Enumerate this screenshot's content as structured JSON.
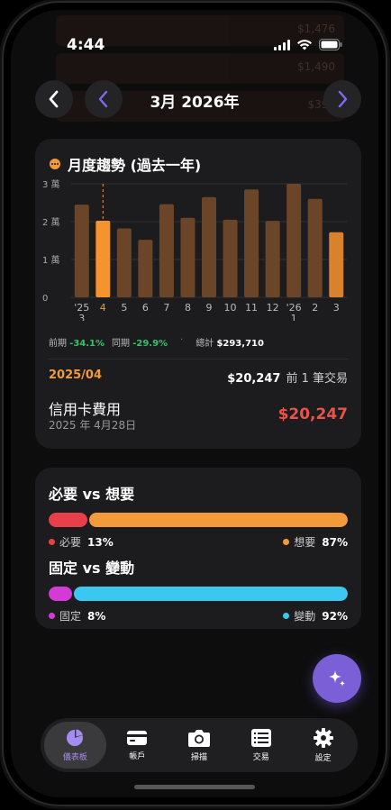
{
  "status": {
    "time": "4:44"
  },
  "background_rows": [
    {
      "amount": "$1,476"
    },
    {
      "amount": "$1,490"
    },
    {
      "amount": "$390"
    }
  ],
  "nav": {
    "title": "3月 2026年"
  },
  "trend": {
    "title": "月度趨勢 (過去一年)",
    "stats": {
      "prev_label": "前期",
      "prev_value": "-34.1%",
      "yoy_label": "同期",
      "yoy_value": "-29.9%",
      "sep": "·",
      "total_label": "總計",
      "total_value": "$293,710"
    },
    "selected": {
      "period": "2025/04",
      "amount": "$20,247",
      "count_text": "前 1 筆交易",
      "tx_name": "信用卡費用",
      "tx_date": "2025 年 4月28日",
      "tx_amount": "$20,247"
    },
    "colors": {
      "bar": "#6b4528",
      "highlight": "#f5942e",
      "current": "#d9822b"
    }
  },
  "chart_data": {
    "type": "bar",
    "title": "月度趨勢 (過去一年)",
    "categories": [
      "'25\n3",
      "4",
      "5",
      "6",
      "7",
      "8",
      "9",
      "10",
      "11",
      "12",
      "'26\n1",
      "2",
      "3"
    ],
    "values": [
      24500,
      20247,
      18200,
      15200,
      24600,
      21000,
      26500,
      20500,
      28500,
      20200,
      30000,
      26000,
      17200
    ],
    "ylim": [
      0,
      30000
    ],
    "yticks": [
      0,
      10000,
      20000,
      30000
    ],
    "ytick_labels": [
      "0",
      "1 萬",
      "2 萬",
      "3 萬"
    ],
    "highlight_index": 1,
    "current_index": 12,
    "grid": true
  },
  "needs_wants": {
    "title": "必要 vs 想要",
    "need_label": "必要",
    "need_pct": "13%",
    "need_value": 13,
    "need_color": "#e8404a",
    "want_label": "想要",
    "want_pct": "87%",
    "want_value": 87,
    "want_color": "#f39a3a"
  },
  "fixed_variable": {
    "title": "固定 vs 變動",
    "fixed_label": "固定",
    "fixed_pct": "8%",
    "fixed_value": 8,
    "fixed_color": "#d63ad6",
    "var_label": "變動",
    "var_pct": "92%",
    "var_value": 92,
    "var_color": "#3ac8f0"
  },
  "tabs": [
    {
      "label": "儀表板",
      "icon": "pie-chart-icon",
      "active": true
    },
    {
      "label": "帳戶",
      "icon": "credit-card-icon",
      "active": false
    },
    {
      "label": "掃描",
      "icon": "camera-icon",
      "active": false
    },
    {
      "label": "交易",
      "icon": "list-icon",
      "active": false
    },
    {
      "label": "設定",
      "icon": "gear-icon",
      "active": false
    }
  ]
}
